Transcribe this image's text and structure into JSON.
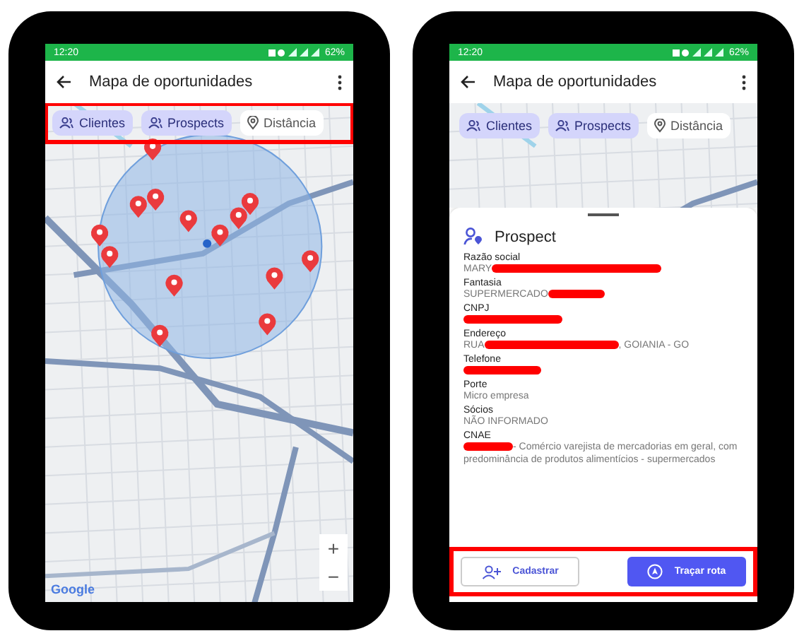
{
  "phones": [
    {
      "status_bar": {
        "time": "12:20",
        "battery": "62%"
      },
      "app_bar": {
        "title": "Mapa de oportunidades"
      },
      "chips": {
        "highlighted": true,
        "items": [
          {
            "label": "Clientes",
            "kind": "people",
            "selected": true
          },
          {
            "label": "Prospects",
            "kind": "people",
            "selected": true
          },
          {
            "label": "Distância",
            "kind": "pin",
            "selected": false
          }
        ]
      },
      "map": {
        "zoom_in": "+",
        "zoom_out": "−",
        "logo": "Google",
        "radius_circle": true
      }
    },
    {
      "status_bar": {
        "time": "12:20",
        "battery": "62%"
      },
      "app_bar": {
        "title": "Mapa de oportunidades"
      },
      "chips": {
        "highlighted": false,
        "items": [
          {
            "label": "Clientes",
            "kind": "people",
            "selected": true
          },
          {
            "label": "Prospects",
            "kind": "people",
            "selected": true
          },
          {
            "label": "Distância",
            "kind": "pin",
            "selected": false
          }
        ]
      },
      "sheet": {
        "title": "Prospect",
        "fields": [
          {
            "label": "Razão social",
            "before": "MARY",
            "redacted": true
          },
          {
            "label": "Fantasia",
            "before": "SUPERMERCADO",
            "redacted": true
          },
          {
            "label": "CNPJ",
            "redacted": true
          },
          {
            "label": "Endereço",
            "before": "RUA",
            "redacted": true,
            "after": ", GOIANIA - GO"
          },
          {
            "label": "Telefone",
            "redacted": true
          },
          {
            "label": "Porte",
            "before": "Micro empresa"
          },
          {
            "label": "Sócios",
            "before": "NÃO INFORMADO"
          },
          {
            "label": "CNAE",
            "redacted": true,
            "after": "- Comércio varejista de mercadorias em geral, com predominância de produtos alimentícios - supermercados"
          }
        ],
        "actions": {
          "highlighted": true,
          "items": [
            {
              "label": "Cadastrar",
              "kind": "outline"
            },
            {
              "label": "Traçar rota",
              "kind": "filled"
            }
          ]
        }
      }
    }
  ]
}
